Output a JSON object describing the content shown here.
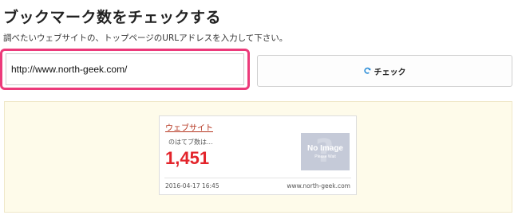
{
  "header": {
    "title": "ブックマーク数をチェックする",
    "instruction": "調べたいウェブサイトの、トップページのURLアドレスを入力して下さい。"
  },
  "form": {
    "url_value": "http://www.north-geek.com/",
    "check_label": "チェック",
    "check_icon": "refresh-icon"
  },
  "result": {
    "site_title": "ウェブサイト",
    "subtitle": "のはてブ数は...",
    "count": "1,451",
    "thumbnail": {
      "text": "No Image",
      "subtext": "Please Wait",
      "mark": "?"
    },
    "date": "2016-04-17 16:45",
    "domain": "www.north-geek.com"
  },
  "colors": {
    "highlight_border": "#ec3a7a",
    "count": "#e3242b",
    "site_link": "#b5351f",
    "result_background": "#fefbea"
  }
}
